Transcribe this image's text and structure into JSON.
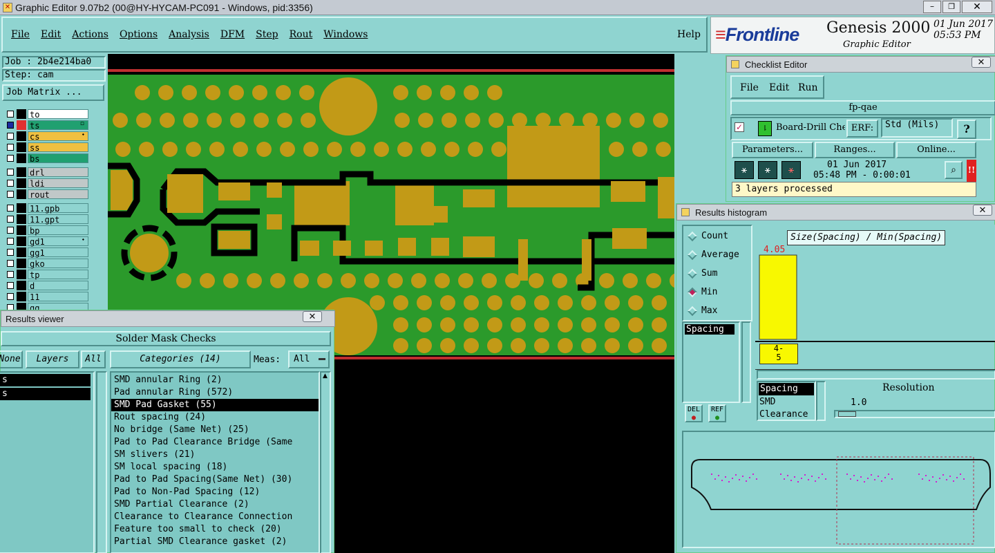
{
  "window": {
    "title": "Graphic Editor 9.07b2 (00@HY-HYCAM-PC091 - Windows, pid:3356)"
  },
  "menubar": {
    "items": [
      "File",
      "Edit",
      "Actions",
      "Options",
      "Analysis",
      "DFM",
      "Step",
      "Rout",
      "Windows"
    ],
    "help": "Help"
  },
  "brand": {
    "logo": "Frontline",
    "product": "Genesis 2000",
    "subtitle": "Graphic Editor",
    "date": "01 Jun 2017",
    "time": "05:53 PM"
  },
  "job": {
    "job_label": "Job : 2b4e214ba0",
    "step_label": "Step: cam",
    "matrix_button": "Job Matrix ..."
  },
  "layers": [
    {
      "name": "to",
      "bg": "#ffffff",
      "color": "#000000"
    },
    {
      "name": "ts",
      "bg": "#20a070",
      "color": "#e03030",
      "sel": true,
      "icon": "▫"
    },
    {
      "name": "cs",
      "bg": "#f0c040",
      "color": "#000000",
      "icon": "⬩"
    },
    {
      "name": "ss",
      "bg": "#f0c040",
      "color": "#000000"
    },
    {
      "name": "bs",
      "bg": "#20a070",
      "color": "#000000"
    },
    {
      "name": "drl",
      "bg": "#c0c8c8",
      "color": "#000000"
    },
    {
      "name": "ldi",
      "bg": "#c0c8c8",
      "color": "#000000"
    },
    {
      "name": "rout",
      "bg": "#c0c8c8",
      "color": "#000000"
    },
    {
      "name": "11.gpb",
      "bg": "#8fd4d0",
      "color": "#000000"
    },
    {
      "name": "11.gpt",
      "bg": "#8fd4d0",
      "color": "#000000"
    },
    {
      "name": "bp",
      "bg": "#8fd4d0",
      "color": "#000000"
    },
    {
      "name": "gd1",
      "bg": "#8fd4d0",
      "color": "#000000",
      "icon": "⬩"
    },
    {
      "name": "gg1",
      "bg": "#8fd4d0",
      "color": "#000000"
    },
    {
      "name": "gko",
      "bg": "#8fd4d0",
      "color": "#000000"
    },
    {
      "name": "tp",
      "bg": "#8fd4d0",
      "color": "#000000"
    },
    {
      "name": "d",
      "bg": "#8fd4d0",
      "color": "#000000"
    },
    {
      "name": "11",
      "bg": "#8fd4d0",
      "color": "#000000"
    },
    {
      "name": "gg",
      "bg": "#8fd4d0",
      "color": "#000000"
    }
  ],
  "results_viewer": {
    "title": "Results viewer",
    "header": "Solder Mask Checks",
    "none_btn": "None",
    "layers_btn": "Layers",
    "all_btn": "All",
    "categories_btn": "Categories (14)",
    "meas_label": "Meas:",
    "meas_value": "All",
    "left_items": [
      "s",
      "s"
    ],
    "categories": [
      "SMD annular Ring (2)",
      "Pad annular Ring (572)",
      "SMD Pad Gasket (55)",
      "Rout spacing (24)",
      "No bridge (Same Net) (25)",
      "Pad to Pad Clearance Bridge (Same",
      "SM slivers (21)",
      "SM local spacing (18)",
      "Pad to Pad Spacing(Same Net) (30)",
      "Pad to Non-Pad Spacing (12)",
      "SMD Partial Clearance (2)",
      "Clearance to Clearance Connection",
      "Feature too small to check (20)",
      "Partial SMD Clearance gasket (2)"
    ],
    "selected_index": 2
  },
  "checklist": {
    "title": "Checklist Editor",
    "menu": [
      "File",
      "Edit",
      "Run"
    ],
    "name": "fp-qae",
    "check_name": "Board-Drill Che",
    "erf_label": "ERF:",
    "erf_value": "Std (Mils)",
    "help": "?",
    "params_btn": "Parameters...",
    "ranges_btn": "Ranges...",
    "online_btn": "Online...",
    "run_date": "01 Jun 2017",
    "run_time": "05:48 PM - 0:00:01",
    "status": "3 layers processed"
  },
  "histogram": {
    "title": "Results histogram",
    "modes": [
      "Count",
      "Average",
      "Sum",
      "Min",
      "Max"
    ],
    "selected_mode": "Min",
    "left_list": [
      "Spacing"
    ],
    "chart_title": "Size(Spacing) / Min(Spacing)",
    "bar_value": "4.05",
    "bar_label": "4-\n5",
    "lower_list": [
      "Spacing",
      "SMD",
      "Clearance"
    ],
    "resolution_label": "Resolution",
    "resolution_value": "1.0",
    "del": "DEL",
    "ref": "REF"
  },
  "chart_data": {
    "type": "bar",
    "categories": [
      "4-5"
    ],
    "values": [
      4.05
    ],
    "title": "Size(Spacing) / Min(Spacing)"
  }
}
